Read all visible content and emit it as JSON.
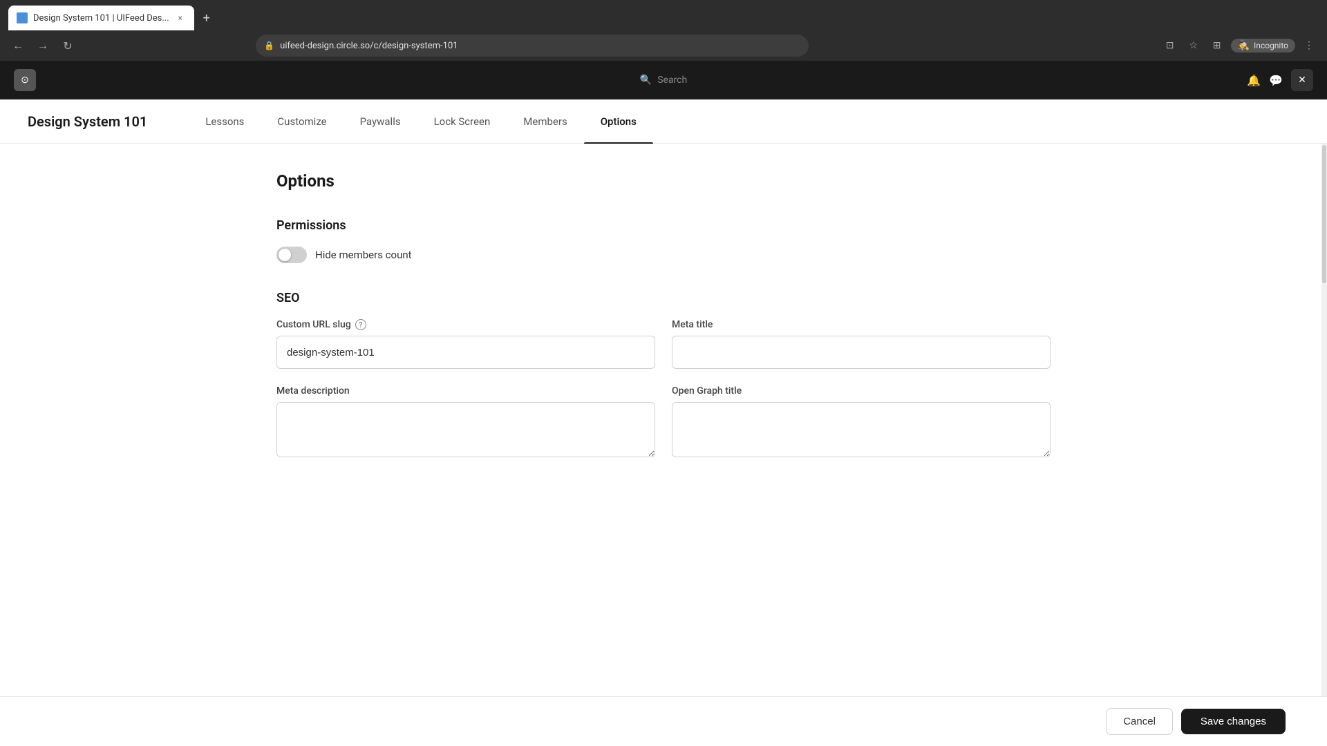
{
  "browser": {
    "tab_title": "Design System 101 | UIFeed Des...",
    "tab_close": "×",
    "new_tab": "+",
    "nav_back": "←",
    "nav_forward": "→",
    "nav_refresh": "↻",
    "address": "uifeed-design.circle.so/c/design-system-101",
    "incognito_label": "Incognito",
    "close_panel": "✕"
  },
  "app_header": {
    "search_placeholder": "Search"
  },
  "course": {
    "title": "Design System 101",
    "tabs": [
      {
        "id": "lessons",
        "label": "Lessons",
        "active": false
      },
      {
        "id": "customize",
        "label": "Customize",
        "active": false
      },
      {
        "id": "paywalls",
        "label": "Paywalls",
        "active": false
      },
      {
        "id": "lock-screen",
        "label": "Lock Screen",
        "active": false
      },
      {
        "id": "members",
        "label": "Members",
        "active": false
      },
      {
        "id": "options",
        "label": "Options",
        "active": true
      }
    ]
  },
  "options_page": {
    "heading": "Options",
    "permissions": {
      "heading": "Permissions",
      "hide_members_toggle": {
        "label": "Hide members count",
        "checked": false
      }
    },
    "seo": {
      "heading": "SEO",
      "custom_url_slug": {
        "label": "Custom URL slug",
        "has_info": true,
        "value": "design-system-101",
        "placeholder": ""
      },
      "meta_title": {
        "label": "Meta title",
        "value": "",
        "placeholder": ""
      },
      "meta_description": {
        "label": "Meta description",
        "value": "",
        "placeholder": ""
      },
      "open_graph_title": {
        "label": "Open Graph title",
        "value": "",
        "placeholder": ""
      }
    }
  },
  "footer": {
    "cancel_label": "Cancel",
    "save_label": "Save changes"
  }
}
